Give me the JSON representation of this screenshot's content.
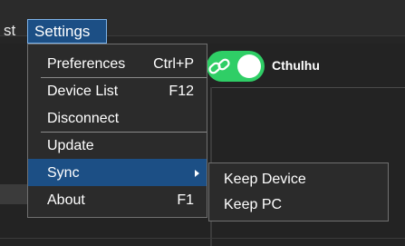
{
  "menubar": {
    "list_tail": "st",
    "settings": "Settings"
  },
  "toggle": {
    "state": "on",
    "color": "#2fce66",
    "icon": "link-icon",
    "device_label": "Cthulhu"
  },
  "settings_menu": {
    "items": [
      {
        "label": "Preferences",
        "shortcut": "Ctrl+P"
      },
      {
        "label": "Device List",
        "shortcut": "F12"
      },
      {
        "label": "Disconnect",
        "shortcut": ""
      },
      {
        "label": "Update",
        "shortcut": ""
      },
      {
        "label": "Sync",
        "shortcut": "",
        "submenu": true
      },
      {
        "label": "About",
        "shortcut": "F1"
      }
    ]
  },
  "sync_submenu": {
    "items": [
      {
        "label": "Keep Device"
      },
      {
        "label": "Keep PC"
      }
    ]
  },
  "colors": {
    "highlight": "#1c4f85",
    "highlight_border": "#7db2e8",
    "menu_bg": "#2b2b2b"
  }
}
